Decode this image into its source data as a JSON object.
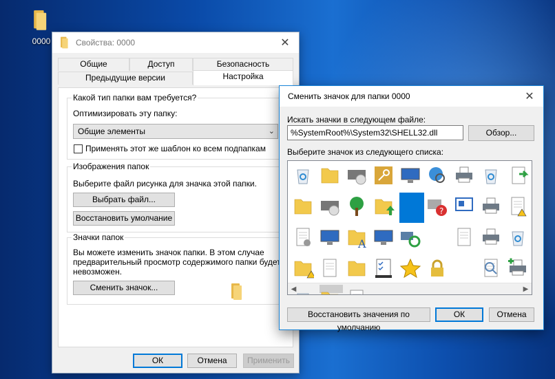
{
  "desktop": {
    "folder_label": "0000"
  },
  "props": {
    "title": "Свойства: 0000",
    "tabs_row1": [
      "Общие",
      "Доступ",
      "Безопасность"
    ],
    "tabs_row2": [
      "Предыдущие версии",
      "Настройка"
    ],
    "group1": {
      "title": "Какой тип папки вам требуется?",
      "optimize_label": "Оптимизировать эту папку:",
      "select_value": "Общие элементы",
      "checkbox_label": "Применять этот же шаблон ко всем подпапкам"
    },
    "group2": {
      "title": "Изображения папок",
      "desc": "Выберите файл рисунка для значка этой папки.",
      "choose_btn": "Выбрать файл...",
      "restore_btn": "Восстановить умолчание"
    },
    "group3": {
      "title": "Значки папок",
      "desc1": "Вы можете изменить значок папки. В этом случае",
      "desc2": "предварительный просмотр содержимого папки будет",
      "desc3": "невозможен.",
      "change_btn": "Сменить значок..."
    },
    "ok": "ОК",
    "cancel": "Отмена",
    "apply": "Применить"
  },
  "dialog": {
    "title": "Сменить значок для папки 0000",
    "search_label": "Искать значки в следующем файле:",
    "file_value": "%SystemRoot%\\System32\\SHELL32.dll",
    "browse": "Обзор...",
    "list_label": "Выберите значок из следующего списка:",
    "restore_defaults": "Восстановить значения по умолчанию",
    "ok": "ОК",
    "cancel": "Отмена",
    "icons": [
      "recycle-bin-full-icon",
      "folder-grid-icon",
      "cd-drive-icon",
      "key-icon",
      "network-computer-icon",
      "globe-search-icon",
      "printer-icon",
      "recycle-bin-empty-icon",
      "green-arrow-doc-icon",
      "folder-settings-icon",
      "drive-icon",
      "tree-icon",
      "folder-upload-icon",
      "blue-tile-selected",
      "no-access-help-icon",
      "presentation-icon",
      "printer-network-icon",
      "warning-doc-icon",
      "gear-doc-icon",
      "desktop-tile-icon",
      "font-folder-icon",
      "monitor-icon",
      "sync-icon",
      "blank",
      "blank-docs-icon",
      "printer-small-icon",
      "recycle-bin-full-icon",
      "folder-warning-icon",
      "document-list-icon",
      "folder-tools-icon",
      "checklist-icon",
      "star-icon",
      "lock-icon",
      "blank",
      "search-doc-icon",
      "add-printer-icon",
      "recycle-bin-icon",
      "folder-edit-icon",
      "settings-doc-icon"
    ],
    "icon_colors": {
      "folder": "#f2c94c",
      "blue": "#0078d7",
      "green": "#2ea043",
      "star": "#f6c21a"
    }
  }
}
